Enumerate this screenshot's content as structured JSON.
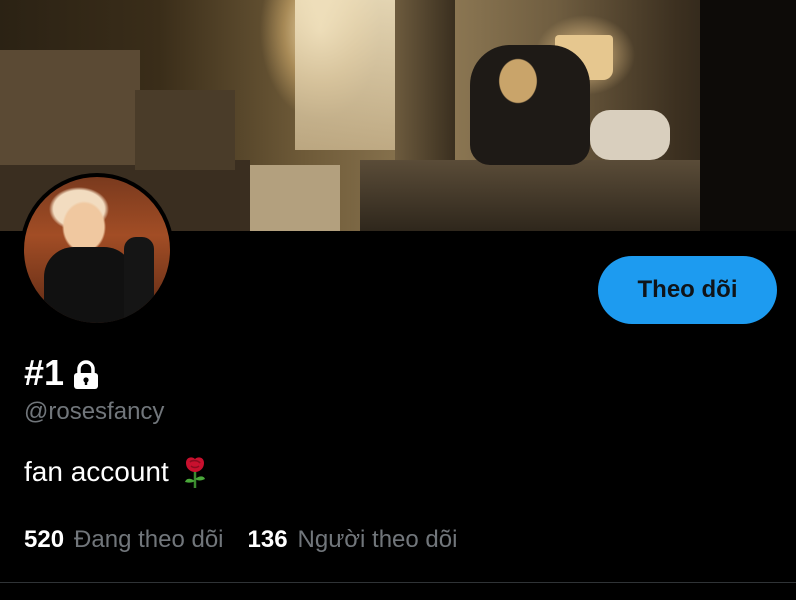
{
  "profile": {
    "display_name": "#1",
    "handle": "@rosesfancy",
    "bio": "fan account",
    "bio_emoji": "rose-icon",
    "protected_icon": "lock-icon"
  },
  "actions": {
    "follow_label": "Theo dõi"
  },
  "stats": {
    "following_count": "520",
    "following_label": "Đang theo dõi",
    "followers_count": "136",
    "followers_label": "Người theo dõi"
  },
  "colors": {
    "background": "#000000",
    "accent": "#1d9bf0",
    "secondary_text": "#71767b"
  }
}
